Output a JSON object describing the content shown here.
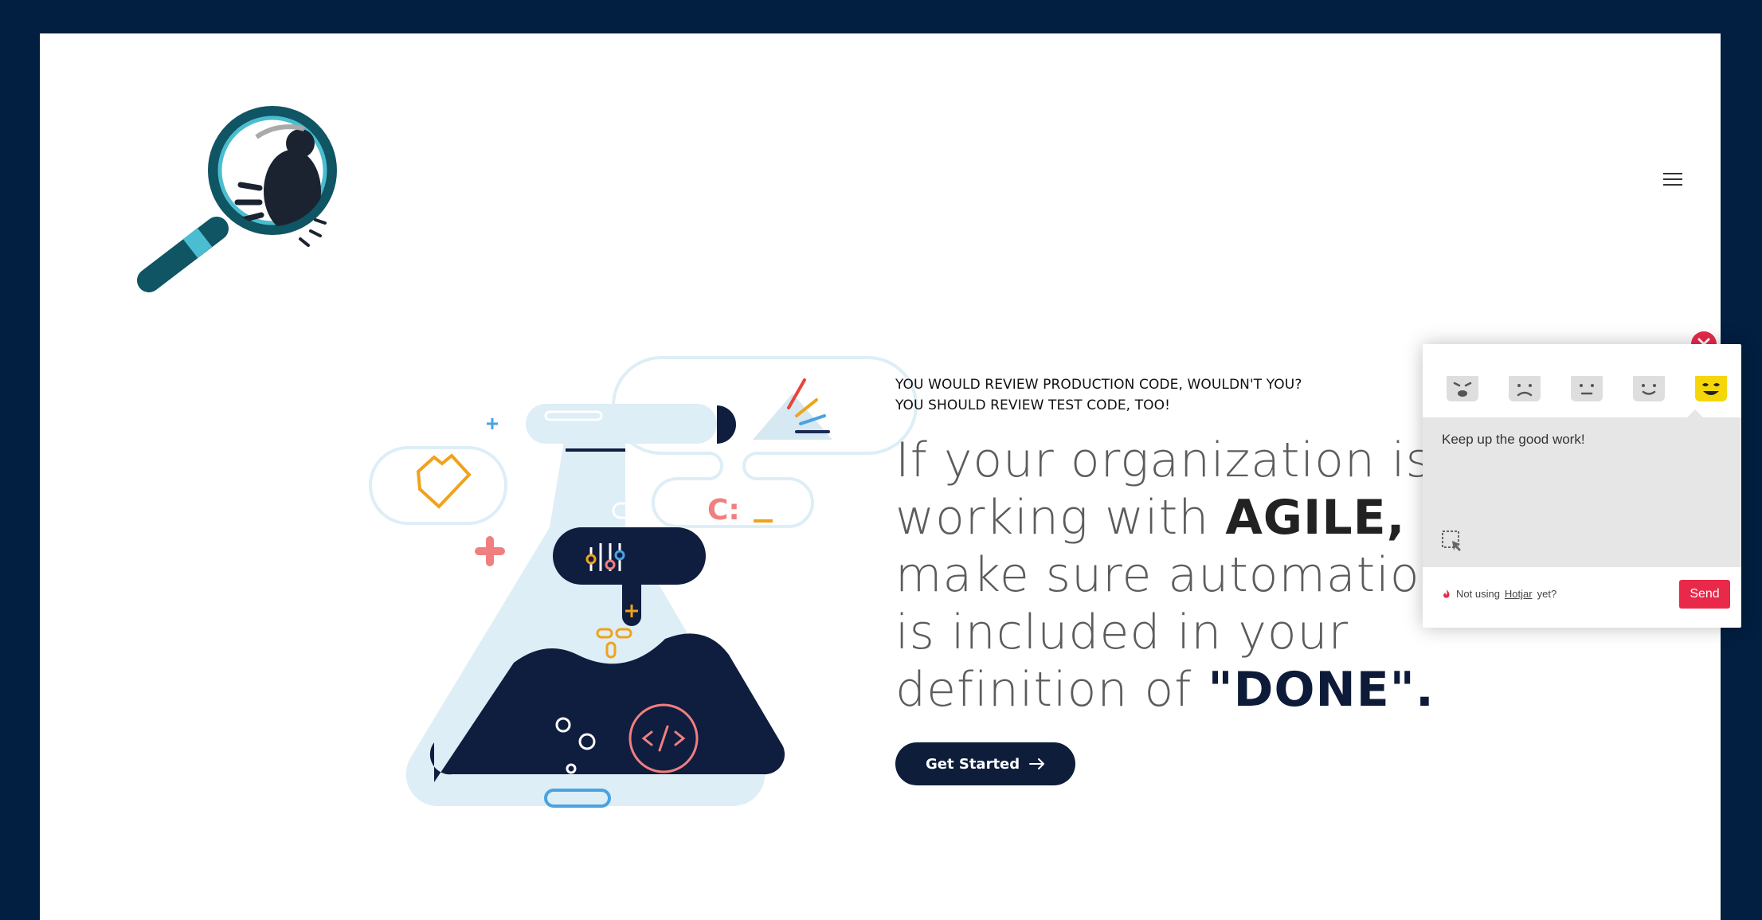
{
  "hero": {
    "eyebrow_line1": "YOU WOULD REVIEW PRODUCTION CODE, WOULDN'T YOU?",
    "eyebrow_line2": "YOU SHOULD REVIEW TEST CODE, TOO!",
    "headline_part1": "If your organization is",
    "headline_part2": "working with ",
    "headline_agile": "AGILE,",
    "headline_part3": "make sure automation",
    "headline_part4": "is included in your",
    "headline_part5": "definition of ",
    "headline_done": "\"DONE\".",
    "cta_label": "Get Started"
  },
  "illustration": {
    "console_prompt": "C:"
  },
  "feedback_widget": {
    "input_value": "Keep up the good work!",
    "footer_prefix": "Not using ",
    "footer_link": "Hotjar",
    "footer_suffix": " yet?",
    "send_label": "Send",
    "faces": [
      "hate-icon",
      "dislike-icon",
      "neutral-icon",
      "like-icon",
      "love-icon"
    ],
    "selected_face": "love-icon"
  },
  "colors": {
    "frame_background": "#021e40",
    "button_navy": "#0d1d3a",
    "send_red": "#e8294a",
    "selected_face_yellow": "#f5d60a",
    "flask_light_blue": "#ddeef6"
  }
}
